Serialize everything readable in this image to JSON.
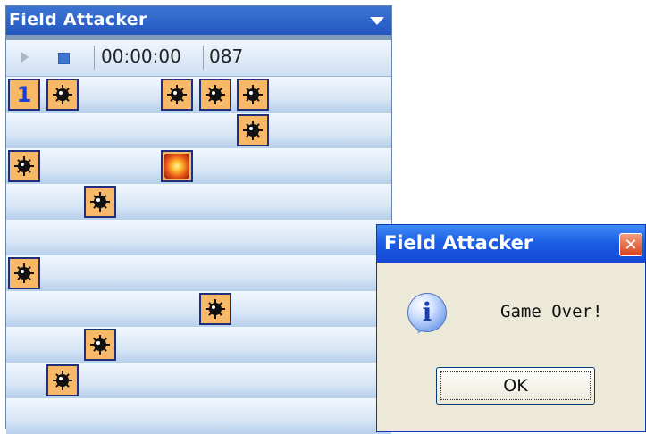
{
  "window": {
    "title": "Field Attacker"
  },
  "toolbar": {
    "play_icon": "play-icon",
    "stop_icon": "stop-icon",
    "timer": "00:00:00",
    "counter": "087"
  },
  "board": {
    "rows": 10,
    "cells": [
      {
        "row": 0,
        "col": 0,
        "type": "number",
        "value": "1"
      },
      {
        "row": 0,
        "col": 1,
        "type": "mine"
      },
      {
        "row": 0,
        "col": 4,
        "type": "mine"
      },
      {
        "row": 0,
        "col": 5,
        "type": "mine"
      },
      {
        "row": 0,
        "col": 6,
        "type": "mine"
      },
      {
        "row": 1,
        "col": 6,
        "type": "mine"
      },
      {
        "row": 2,
        "col": 0,
        "type": "mine"
      },
      {
        "row": 2,
        "col": 4,
        "type": "exploded-mine"
      },
      {
        "row": 3,
        "col": 2,
        "type": "mine"
      },
      {
        "row": 5,
        "col": 0,
        "type": "mine"
      },
      {
        "row": 6,
        "col": 5,
        "type": "mine"
      },
      {
        "row": 7,
        "col": 2,
        "type": "mine"
      },
      {
        "row": 8,
        "col": 1,
        "type": "mine"
      }
    ]
  },
  "dialog": {
    "title": "Field Attacker",
    "close_glyph": "✕",
    "icon": "info-icon",
    "icon_glyph": "i",
    "message": "Game Over!",
    "ok_label": "OK"
  },
  "colors": {
    "title_bar": "#2358c2",
    "tile": "#f7b868",
    "tile_border": "#1f2f7a",
    "number": "#1b3cd6",
    "dialog_title_bar": "#1c5fe4",
    "dialog_close": "#d9421c"
  }
}
